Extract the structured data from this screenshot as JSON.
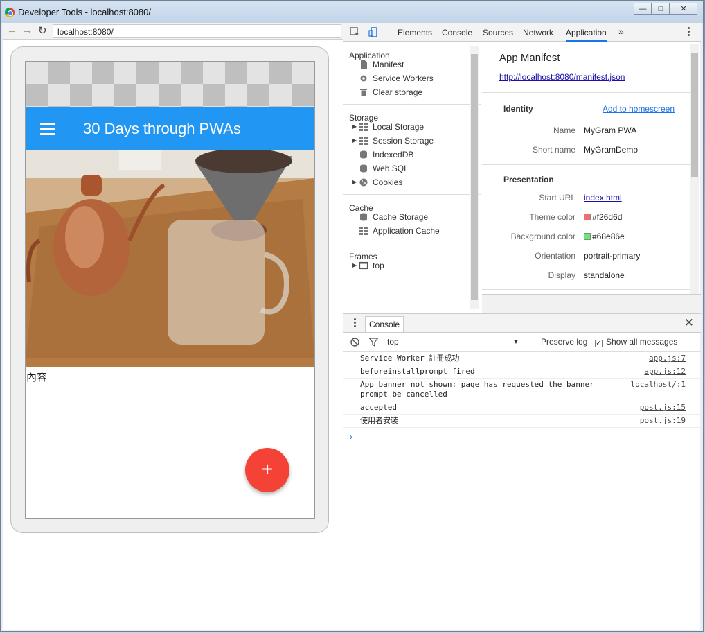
{
  "window": {
    "title": "Developer Tools - localhost:8080/",
    "buttons": [
      "minimize",
      "maximize",
      "close"
    ]
  },
  "browser": {
    "url": "localhost:8080/",
    "app": {
      "title": "30 Days through PWAs",
      "content_text": "內容",
      "fab_label": "+"
    }
  },
  "devtools": {
    "tabs": [
      "Elements",
      "Console",
      "Sources",
      "Network",
      "Application"
    ],
    "active_tab": "Application",
    "more_tabs": "»",
    "sidebar": {
      "application": {
        "heading": "Application",
        "items": [
          {
            "label": "Manifest",
            "icon": "document-icon"
          },
          {
            "label": "Service Workers",
            "icon": "gear-icon"
          },
          {
            "label": "Clear storage",
            "icon": "trash-icon"
          }
        ]
      },
      "storage": {
        "heading": "Storage",
        "items": [
          {
            "label": "Local Storage",
            "icon": "grid-icon",
            "expandable": true
          },
          {
            "label": "Session Storage",
            "icon": "grid-icon",
            "expandable": true
          },
          {
            "label": "IndexedDB",
            "icon": "database-icon",
            "expandable": false
          },
          {
            "label": "Web SQL",
            "icon": "database-icon",
            "expandable": false
          },
          {
            "label": "Cookies",
            "icon": "cookie-icon",
            "expandable": true
          }
        ]
      },
      "cache": {
        "heading": "Cache",
        "items": [
          {
            "label": "Cache Storage",
            "icon": "database-icon"
          },
          {
            "label": "Application Cache",
            "icon": "grid-icon"
          }
        ]
      },
      "frames": {
        "heading": "Frames",
        "items": [
          {
            "label": "top",
            "icon": "frame-icon",
            "expandable": true
          }
        ]
      }
    },
    "manifest": {
      "title": "App Manifest",
      "url": "http://localhost:8080/manifest.json",
      "identity": {
        "heading": "Identity",
        "add_to_homescreen": "Add to homescreen",
        "name_label": "Name",
        "name": "MyGram PWA",
        "short_name_label": "Short name",
        "short_name": "MyGramDemo"
      },
      "presentation": {
        "heading": "Presentation",
        "start_url_label": "Start URL",
        "start_url": "index.html",
        "theme_color_label": "Theme color",
        "theme_color": "#f26d6d",
        "background_color_label": "Background color",
        "background_color": "#68e86e",
        "orientation_label": "Orientation",
        "orientation": "portrait-primary",
        "display_label": "Display",
        "display": "standalone"
      }
    },
    "drawer": {
      "tab": "Console",
      "context": "top",
      "preserve_log": "Preserve log",
      "preserve_log_checked": false,
      "show_all": "Show all messages",
      "show_all_checked": true,
      "messages": [
        {
          "text": "Service Worker 註冊成功",
          "source": "app.js:7"
        },
        {
          "text": "beforeinstallprompt fired",
          "source": "app.js:12"
        },
        {
          "text": "App banner not shown: page has requested the banner prompt be cancelled",
          "source": "localhost/:1"
        },
        {
          "text": "accepted",
          "source": "post.js:15"
        },
        {
          "text": "使用者安裝",
          "source": "post.js:19"
        }
      ],
      "prompt": "›"
    }
  }
}
